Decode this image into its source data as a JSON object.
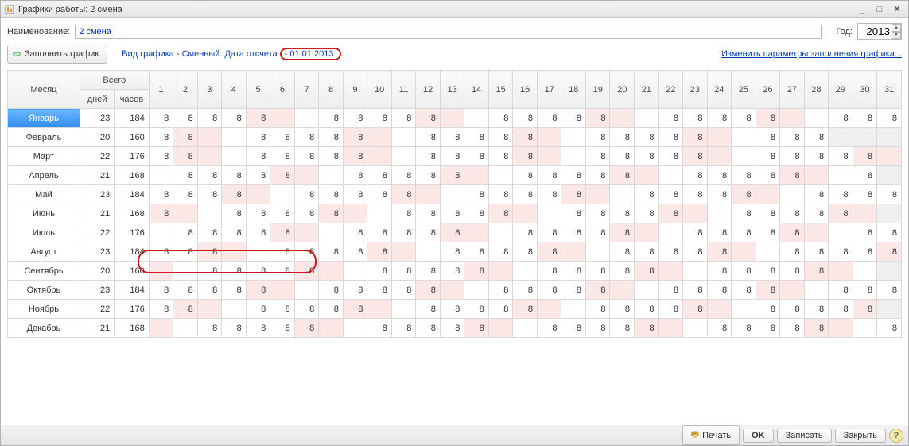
{
  "window": {
    "title": "Графики работы: 2 смена"
  },
  "labels": {
    "name": "Наименование:",
    "year": "Год:",
    "fill": "Заполнить график",
    "info_prefix": "Вид графика - Сменный. Дата отсчета ",
    "info_date": "- 01.01.2013.",
    "change_link": "Изменить параметры заполнения графика..."
  },
  "inputs": {
    "name_value": "2 смена",
    "year_value": "2013"
  },
  "headers": {
    "month": "Месяц",
    "total": "Всего",
    "days": "дней",
    "hours": "часов"
  },
  "day_numbers": [
    "1",
    "2",
    "3",
    "4",
    "5",
    "6",
    "7",
    "8",
    "9",
    "10",
    "11",
    "12",
    "13",
    "14",
    "15",
    "16",
    "17",
    "18",
    "19",
    "20",
    "21",
    "22",
    "23",
    "24",
    "25",
    "26",
    "27",
    "28",
    "29",
    "30",
    "31"
  ],
  "months": [
    {
      "name": "Январь",
      "days": 23,
      "hours": 184,
      "len": 31,
      "cells": [
        {
          "v": "8"
        },
        {
          "v": "8"
        },
        {
          "v": "8"
        },
        {
          "v": "8"
        },
        {
          "v": "8",
          "we": true
        },
        {
          "v": "",
          "we": true
        },
        {
          "v": ""
        },
        {
          "v": "8"
        },
        {
          "v": "8"
        },
        {
          "v": "8"
        },
        {
          "v": "8"
        },
        {
          "v": "8",
          "we": true
        },
        {
          "v": "",
          "we": true
        },
        {
          "v": ""
        },
        {
          "v": "8"
        },
        {
          "v": "8"
        },
        {
          "v": "8"
        },
        {
          "v": "8"
        },
        {
          "v": "8",
          "we": true
        },
        {
          "v": "",
          "we": true
        },
        {
          "v": ""
        },
        {
          "v": "8"
        },
        {
          "v": "8"
        },
        {
          "v": "8"
        },
        {
          "v": "8"
        },
        {
          "v": "8",
          "we": true
        },
        {
          "v": "",
          "we": true
        },
        {
          "v": ""
        },
        {
          "v": "8"
        },
        {
          "v": "8"
        },
        {
          "v": "8"
        }
      ]
    },
    {
      "name": "Февраль",
      "days": 20,
      "hours": 160,
      "len": 28,
      "cells": [
        {
          "v": "8"
        },
        {
          "v": "8",
          "we": true
        },
        {
          "v": "",
          "we": true
        },
        {
          "v": ""
        },
        {
          "v": "8"
        },
        {
          "v": "8"
        },
        {
          "v": "8"
        },
        {
          "v": "8"
        },
        {
          "v": "8",
          "we": true
        },
        {
          "v": "",
          "we": true
        },
        {
          "v": ""
        },
        {
          "v": "8"
        },
        {
          "v": "8"
        },
        {
          "v": "8"
        },
        {
          "v": "8"
        },
        {
          "v": "8",
          "we": true
        },
        {
          "v": "",
          "we": true
        },
        {
          "v": ""
        },
        {
          "v": "8"
        },
        {
          "v": "8"
        },
        {
          "v": "8"
        },
        {
          "v": "8"
        },
        {
          "v": "8",
          "we": true
        },
        {
          "v": "",
          "we": true
        },
        {
          "v": ""
        },
        {
          "v": "8"
        },
        {
          "v": "8"
        },
        {
          "v": "8"
        }
      ]
    },
    {
      "name": "Март",
      "days": 22,
      "hours": 176,
      "len": 31,
      "cells": [
        {
          "v": "8"
        },
        {
          "v": "8",
          "we": true
        },
        {
          "v": "",
          "we": true
        },
        {
          "v": ""
        },
        {
          "v": "8"
        },
        {
          "v": "8"
        },
        {
          "v": "8"
        },
        {
          "v": "8"
        },
        {
          "v": "8",
          "we": true
        },
        {
          "v": "",
          "we": true
        },
        {
          "v": ""
        },
        {
          "v": "8"
        },
        {
          "v": "8"
        },
        {
          "v": "8"
        },
        {
          "v": "8"
        },
        {
          "v": "8",
          "we": true
        },
        {
          "v": "",
          "we": true
        },
        {
          "v": ""
        },
        {
          "v": "8"
        },
        {
          "v": "8"
        },
        {
          "v": "8"
        },
        {
          "v": "8"
        },
        {
          "v": "8",
          "we": true
        },
        {
          "v": "",
          "we": true
        },
        {
          "v": ""
        },
        {
          "v": "8"
        },
        {
          "v": "8"
        },
        {
          "v": "8"
        },
        {
          "v": "8"
        },
        {
          "v": "8",
          "we": true
        },
        {
          "v": "",
          "we": true
        }
      ]
    },
    {
      "name": "Апрель",
      "days": 21,
      "hours": 168,
      "len": 30,
      "cells": [
        {
          "v": ""
        },
        {
          "v": "8"
        },
        {
          "v": "8"
        },
        {
          "v": "8"
        },
        {
          "v": "8"
        },
        {
          "v": "8",
          "we": true
        },
        {
          "v": "",
          "we": true
        },
        {
          "v": ""
        },
        {
          "v": "8"
        },
        {
          "v": "8"
        },
        {
          "v": "8"
        },
        {
          "v": "8"
        },
        {
          "v": "8",
          "we": true
        },
        {
          "v": "",
          "we": true
        },
        {
          "v": ""
        },
        {
          "v": "8"
        },
        {
          "v": "8"
        },
        {
          "v": "8"
        },
        {
          "v": "8"
        },
        {
          "v": "8",
          "we": true
        },
        {
          "v": "",
          "we": true
        },
        {
          "v": ""
        },
        {
          "v": "8"
        },
        {
          "v": "8"
        },
        {
          "v": "8"
        },
        {
          "v": "8"
        },
        {
          "v": "8",
          "we": true
        },
        {
          "v": "",
          "we": true
        },
        {
          "v": ""
        },
        {
          "v": "8"
        }
      ]
    },
    {
      "name": "Май",
      "days": 23,
      "hours": 184,
      "len": 31,
      "cells": [
        {
          "v": "8"
        },
        {
          "v": "8"
        },
        {
          "v": "8"
        },
        {
          "v": "8",
          "we": true
        },
        {
          "v": "",
          "we": true
        },
        {
          "v": ""
        },
        {
          "v": "8"
        },
        {
          "v": "8"
        },
        {
          "v": "8"
        },
        {
          "v": "8"
        },
        {
          "v": "8",
          "we": true
        },
        {
          "v": "",
          "we": true
        },
        {
          "v": ""
        },
        {
          "v": "8"
        },
        {
          "v": "8"
        },
        {
          "v": "8"
        },
        {
          "v": "8"
        },
        {
          "v": "8",
          "we": true
        },
        {
          "v": "",
          "we": true
        },
        {
          "v": ""
        },
        {
          "v": "8"
        },
        {
          "v": "8"
        },
        {
          "v": "8"
        },
        {
          "v": "8"
        },
        {
          "v": "8",
          "we": true
        },
        {
          "v": "",
          "we": true
        },
        {
          "v": ""
        },
        {
          "v": "8"
        },
        {
          "v": "8"
        },
        {
          "v": "8"
        },
        {
          "v": "8"
        }
      ]
    },
    {
      "name": "Июнь",
      "days": 21,
      "hours": 168,
      "len": 30,
      "cells": [
        {
          "v": "8",
          "we": true
        },
        {
          "v": "",
          "we": true
        },
        {
          "v": ""
        },
        {
          "v": "8"
        },
        {
          "v": "8"
        },
        {
          "v": "8"
        },
        {
          "v": "8"
        },
        {
          "v": "8",
          "we": true
        },
        {
          "v": "",
          "we": true
        },
        {
          "v": ""
        },
        {
          "v": "8"
        },
        {
          "v": "8"
        },
        {
          "v": "8"
        },
        {
          "v": "8"
        },
        {
          "v": "8",
          "we": true
        },
        {
          "v": "",
          "we": true
        },
        {
          "v": ""
        },
        {
          "v": "8"
        },
        {
          "v": "8"
        },
        {
          "v": "8"
        },
        {
          "v": "8"
        },
        {
          "v": "8",
          "we": true
        },
        {
          "v": "",
          "we": true
        },
        {
          "v": ""
        },
        {
          "v": "8"
        },
        {
          "v": "8"
        },
        {
          "v": "8"
        },
        {
          "v": "8"
        },
        {
          "v": "8",
          "we": true
        },
        {
          "v": "",
          "we": true
        }
      ]
    },
    {
      "name": "Июль",
      "days": 22,
      "hours": 176,
      "len": 31,
      "cells": [
        {
          "v": ""
        },
        {
          "v": "8"
        },
        {
          "v": "8"
        },
        {
          "v": "8"
        },
        {
          "v": "8"
        },
        {
          "v": "8",
          "we": true
        },
        {
          "v": "",
          "we": true
        },
        {
          "v": ""
        },
        {
          "v": "8"
        },
        {
          "v": "8"
        },
        {
          "v": "8"
        },
        {
          "v": "8"
        },
        {
          "v": "8",
          "we": true
        },
        {
          "v": "",
          "we": true
        },
        {
          "v": ""
        },
        {
          "v": "8"
        },
        {
          "v": "8"
        },
        {
          "v": "8"
        },
        {
          "v": "8"
        },
        {
          "v": "8",
          "we": true
        },
        {
          "v": "",
          "we": true
        },
        {
          "v": ""
        },
        {
          "v": "8"
        },
        {
          "v": "8"
        },
        {
          "v": "8"
        },
        {
          "v": "8"
        },
        {
          "v": "8",
          "we": true
        },
        {
          "v": "",
          "we": true
        },
        {
          "v": ""
        },
        {
          "v": "8"
        },
        {
          "v": "8"
        }
      ]
    },
    {
      "name": "Август",
      "days": 23,
      "hours": 184,
      "len": 31,
      "cells": [
        {
          "v": "8"
        },
        {
          "v": "8"
        },
        {
          "v": "8",
          "we": true
        },
        {
          "v": "",
          "we": true
        },
        {
          "v": ""
        },
        {
          "v": "8"
        },
        {
          "v": "8"
        },
        {
          "v": "8"
        },
        {
          "v": "8"
        },
        {
          "v": "8",
          "we": true
        },
        {
          "v": "",
          "we": true
        },
        {
          "v": ""
        },
        {
          "v": "8"
        },
        {
          "v": "8"
        },
        {
          "v": "8"
        },
        {
          "v": "8"
        },
        {
          "v": "8",
          "we": true
        },
        {
          "v": "",
          "we": true
        },
        {
          "v": ""
        },
        {
          "v": "8"
        },
        {
          "v": "8"
        },
        {
          "v": "8"
        },
        {
          "v": "8"
        },
        {
          "v": "8",
          "we": true
        },
        {
          "v": "",
          "we": true
        },
        {
          "v": ""
        },
        {
          "v": "8"
        },
        {
          "v": "8"
        },
        {
          "v": "8"
        },
        {
          "v": "8"
        },
        {
          "v": "8",
          "we": true
        }
      ]
    },
    {
      "name": "Сентябрь",
      "days": 20,
      "hours": 160,
      "len": 30,
      "cells": [
        {
          "v": "",
          "we": true
        },
        {
          "v": ""
        },
        {
          "v": "8"
        },
        {
          "v": "8"
        },
        {
          "v": "8"
        },
        {
          "v": "8"
        },
        {
          "v": "8",
          "we": true
        },
        {
          "v": "",
          "we": true
        },
        {
          "v": ""
        },
        {
          "v": "8"
        },
        {
          "v": "8"
        },
        {
          "v": "8"
        },
        {
          "v": "8"
        },
        {
          "v": "8",
          "we": true
        },
        {
          "v": "",
          "we": true
        },
        {
          "v": ""
        },
        {
          "v": "8"
        },
        {
          "v": "8"
        },
        {
          "v": "8"
        },
        {
          "v": "8"
        },
        {
          "v": "8",
          "we": true
        },
        {
          "v": "",
          "we": true
        },
        {
          "v": ""
        },
        {
          "v": "8"
        },
        {
          "v": "8"
        },
        {
          "v": "8"
        },
        {
          "v": "8"
        },
        {
          "v": "8",
          "we": true
        },
        {
          "v": "",
          "we": true
        },
        {
          "v": ""
        }
      ]
    },
    {
      "name": "Октябрь",
      "days": 23,
      "hours": 184,
      "len": 31,
      "cells": [
        {
          "v": "8"
        },
        {
          "v": "8"
        },
        {
          "v": "8"
        },
        {
          "v": "8"
        },
        {
          "v": "8",
          "we": true
        },
        {
          "v": "",
          "we": true
        },
        {
          "v": ""
        },
        {
          "v": "8"
        },
        {
          "v": "8"
        },
        {
          "v": "8"
        },
        {
          "v": "8"
        },
        {
          "v": "8",
          "we": true
        },
        {
          "v": "",
          "we": true
        },
        {
          "v": ""
        },
        {
          "v": "8"
        },
        {
          "v": "8"
        },
        {
          "v": "8"
        },
        {
          "v": "8"
        },
        {
          "v": "8",
          "we": true
        },
        {
          "v": "",
          "we": true
        },
        {
          "v": ""
        },
        {
          "v": "8"
        },
        {
          "v": "8"
        },
        {
          "v": "8"
        },
        {
          "v": "8"
        },
        {
          "v": "8",
          "we": true
        },
        {
          "v": "",
          "we": true
        },
        {
          "v": ""
        },
        {
          "v": "8"
        },
        {
          "v": "8"
        },
        {
          "v": "8"
        }
      ]
    },
    {
      "name": "Ноябрь",
      "days": 22,
      "hours": 176,
      "len": 30,
      "cells": [
        {
          "v": "8"
        },
        {
          "v": "8",
          "we": true
        },
        {
          "v": "",
          "we": true
        },
        {
          "v": ""
        },
        {
          "v": "8"
        },
        {
          "v": "8"
        },
        {
          "v": "8"
        },
        {
          "v": "8"
        },
        {
          "v": "8",
          "we": true
        },
        {
          "v": "",
          "we": true
        },
        {
          "v": ""
        },
        {
          "v": "8"
        },
        {
          "v": "8"
        },
        {
          "v": "8"
        },
        {
          "v": "8"
        },
        {
          "v": "8",
          "we": true
        },
        {
          "v": "",
          "we": true
        },
        {
          "v": ""
        },
        {
          "v": "8"
        },
        {
          "v": "8"
        },
        {
          "v": "8"
        },
        {
          "v": "8"
        },
        {
          "v": "8",
          "we": true
        },
        {
          "v": "",
          "we": true
        },
        {
          "v": ""
        },
        {
          "v": "8"
        },
        {
          "v": "8"
        },
        {
          "v": "8"
        },
        {
          "v": "8"
        },
        {
          "v": "8",
          "we": true
        }
      ]
    },
    {
      "name": "Декабрь",
      "days": 21,
      "hours": 168,
      "len": 31,
      "cells": [
        {
          "v": "",
          "we": true
        },
        {
          "v": ""
        },
        {
          "v": "8"
        },
        {
          "v": "8"
        },
        {
          "v": "8"
        },
        {
          "v": "8"
        },
        {
          "v": "8",
          "we": true
        },
        {
          "v": "",
          "we": true
        },
        {
          "v": ""
        },
        {
          "v": "8"
        },
        {
          "v": "8"
        },
        {
          "v": "8"
        },
        {
          "v": "8"
        },
        {
          "v": "8",
          "we": true
        },
        {
          "v": "",
          "we": true
        },
        {
          "v": ""
        },
        {
          "v": "8"
        },
        {
          "v": "8"
        },
        {
          "v": "8"
        },
        {
          "v": "8"
        },
        {
          "v": "8",
          "we": true
        },
        {
          "v": "",
          "we": true
        },
        {
          "v": ""
        },
        {
          "v": "8"
        },
        {
          "v": "8"
        },
        {
          "v": "8"
        },
        {
          "v": "8"
        },
        {
          "v": "8",
          "we": true
        },
        {
          "v": "",
          "we": true
        },
        {
          "v": ""
        },
        {
          "v": "8"
        }
      ]
    }
  ],
  "footer": {
    "print": "Печать",
    "ok": "OK",
    "save": "Записать",
    "close": "Закрыть"
  }
}
